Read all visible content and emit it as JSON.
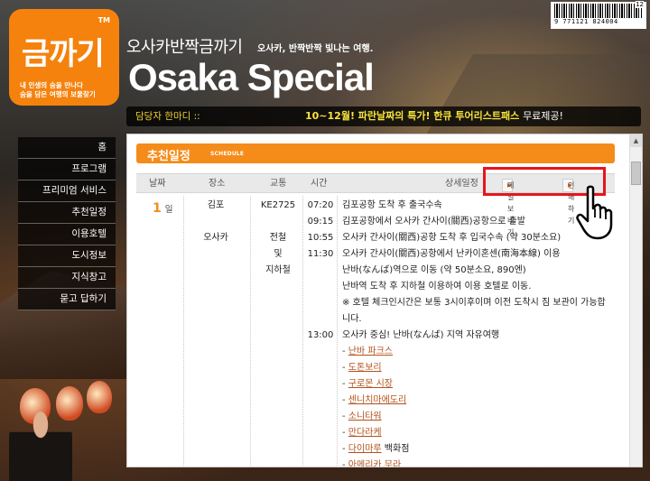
{
  "branding": {
    "logo_name": "금까기",
    "logo_tm": "TM",
    "logo_tagline_1": "내 인생의 숨을 만나다",
    "logo_tagline_2": "숨을 담은 여행의 보물찾기",
    "korean_title": "오사카반짝금까기",
    "korean_subtitle": "오사카, 반짝반짝 빛나는 여행.",
    "english_title": "Osaka Special"
  },
  "barcode": {
    "number": "9 771121 824004",
    "issue": "12"
  },
  "notice": {
    "label": "담당자 한마디 ::",
    "message_highlight": "10~12월! 파란날짜의 특가! 한큐 투어리스트패스 ",
    "message_normal": "무료제공!"
  },
  "nav": {
    "items": [
      "홈",
      "프로그램",
      "프리미엄 서비스",
      "추천일정",
      "이용호텔",
      "도시정보",
      "지식창고",
      "묻고 답하기"
    ]
  },
  "panel": {
    "title": "추천일정",
    "title_en": "SCHEDULE",
    "columns": {
      "date": "날짜",
      "place": "장소",
      "transport": "교통",
      "time": "시간",
      "detail": "상세일정"
    },
    "buttons": {
      "mail": "메일보내기",
      "print": "인쇄하기"
    }
  },
  "schedule": {
    "day_number": "1",
    "day_unit": "일",
    "places": [
      "김포",
      "오사카"
    ],
    "transport": {
      "flight": "KE2725",
      "train_1": "전철",
      "train_2": "및",
      "train_3": "지하철"
    },
    "times": [
      "07:20",
      "09:15",
      "10:55",
      "11:30",
      "13:00"
    ],
    "details": [
      "김포공항 도착 후 출국수속",
      "김포공항에서 오사카 간사이(關西)공항으로 출발",
      "오사카 간사이(關西)공항 도착 후 입국수속 (약 30분소요)",
      "오사카 간사이(關西)공항에서 난카이혼센(南海本線) 이용",
      "난바(なんば)역으로 이동 (약 50분소요, 890엔)",
      "난바역 도착 후 지하철 이용하여 이용 호텔로 이동.",
      "※ 호텔 체크인시간은 보통 3시이후이며 이전 도착시 짐 보관이 가능합",
      "니다.",
      "오사카 중심! 난바(なんば) 지역 자유여행"
    ],
    "sights": [
      "난바 파크스",
      "도톤보리",
      "구로몬 시장",
      "센니치마에도리",
      "소니타워",
      "만다라케",
      "다이마루",
      "아메리카 무라"
    ],
    "sight_suffix_daimaru": " 백화점"
  },
  "colors": {
    "brand_orange": "#f58c1a",
    "notice_yellow": "#f7e53a",
    "highlight_red": "#e5161b",
    "sight_link": "#b4511a"
  }
}
